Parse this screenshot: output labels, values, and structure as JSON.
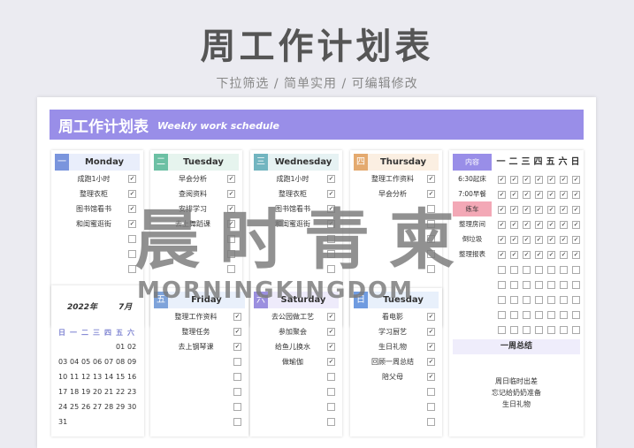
{
  "hero": {
    "title": "周工作计划表",
    "subtitle": "下拉筛选 / 简单实用 / 可编辑修改"
  },
  "banner": {
    "title": "周工作计划表",
    "subtitle": "Weekly work schedule"
  },
  "colors": {
    "purple": "#998ee8",
    "monday": "#7a95dd",
    "tuesday": "#6cc0a4",
    "wednesday": "#72b5c0",
    "thursday": "#e4aa6f",
    "friday": "#7ea3da",
    "saturday": "#9b8fdf",
    "sunday": "#6f9be0"
  },
  "days": [
    {
      "num": "一",
      "name": "Monday",
      "tasks": [
        {
          "text": "成跑1小时",
          "done": true
        },
        {
          "text": "整理衣柜",
          "done": true
        },
        {
          "text": "图书馆看书",
          "done": true
        },
        {
          "text": "和闺蜜逛街",
          "done": true
        },
        {
          "text": "",
          "done": false
        },
        {
          "text": "",
          "done": false
        },
        {
          "text": "",
          "done": false
        }
      ]
    },
    {
      "num": "二",
      "name": "Tuesday",
      "tasks": [
        {
          "text": "早会分析",
          "done": true
        },
        {
          "text": "查阅资料",
          "done": true
        },
        {
          "text": "安排学习",
          "done": true
        },
        {
          "text": "去上舞蹈课",
          "done": true
        },
        {
          "text": "",
          "done": false
        },
        {
          "text": "",
          "done": false
        },
        {
          "text": "",
          "done": false
        }
      ]
    },
    {
      "num": "三",
      "name": "Wednesday",
      "tasks": [
        {
          "text": "成跑1小时",
          "done": true
        },
        {
          "text": "整理衣柜",
          "done": true
        },
        {
          "text": "图书馆看书",
          "done": true
        },
        {
          "text": "和闺蜜逛街",
          "done": true
        },
        {
          "text": "",
          "done": false
        },
        {
          "text": "",
          "done": false
        },
        {
          "text": "",
          "done": false
        }
      ]
    },
    {
      "num": "四",
      "name": "Thursday",
      "tasks": [
        {
          "text": "整理工作资料",
          "done": true
        },
        {
          "text": "早会分析",
          "done": true
        },
        {
          "text": "",
          "done": false
        },
        {
          "text": "",
          "done": false
        },
        {
          "text": "",
          "done": false
        },
        {
          "text": "",
          "done": false
        },
        {
          "text": "",
          "done": false
        }
      ]
    },
    {
      "num": "五",
      "name": "Friday",
      "tasks": [
        {
          "text": "整理工作资料",
          "done": true
        },
        {
          "text": "整理任务",
          "done": true
        },
        {
          "text": "去上钢琴课",
          "done": true
        },
        {
          "text": "",
          "done": false
        },
        {
          "text": "",
          "done": false
        },
        {
          "text": "",
          "done": false
        },
        {
          "text": "",
          "done": false
        },
        {
          "text": "",
          "done": false
        }
      ]
    },
    {
      "num": "六",
      "name": "Saturday",
      "tasks": [
        {
          "text": "去公园做工艺",
          "done": true
        },
        {
          "text": "参加聚会",
          "done": true
        },
        {
          "text": "给鱼儿换水",
          "done": true
        },
        {
          "text": "做瑜伽",
          "done": true
        },
        {
          "text": "",
          "done": false
        },
        {
          "text": "",
          "done": false
        },
        {
          "text": "",
          "done": false
        },
        {
          "text": "",
          "done": false
        }
      ]
    },
    {
      "num": "日",
      "name": "Tuesday",
      "tasks": [
        {
          "text": "看电影",
          "done": true
        },
        {
          "text": "学习厨艺",
          "done": true
        },
        {
          "text": "生日礼物",
          "done": true
        },
        {
          "text": "回顾一周总结",
          "done": true
        },
        {
          "text": "陪父母",
          "done": true
        },
        {
          "text": "",
          "done": false
        },
        {
          "text": "",
          "done": false
        },
        {
          "text": "",
          "done": false
        }
      ]
    }
  ],
  "calendar": {
    "year": "2022年",
    "month": "7月",
    "weekdays": [
      "日",
      "一",
      "二",
      "三",
      "四",
      "五",
      "六"
    ],
    "weeks": [
      [
        "",
        "",
        "",
        "",
        "",
        "01",
        "02"
      ],
      [
        "03",
        "04",
        "05",
        "06",
        "07",
        "08",
        "09"
      ],
      [
        "10",
        "11",
        "12",
        "13",
        "14",
        "15",
        "16"
      ],
      [
        "17",
        "18",
        "19",
        "20",
        "21",
        "22",
        "23"
      ],
      [
        "24",
        "25",
        "26",
        "27",
        "28",
        "29",
        "30"
      ],
      [
        "31",
        "",
        "",
        "",
        "",
        "",
        ""
      ]
    ]
  },
  "habits": {
    "header": "内容",
    "days": [
      "一",
      "二",
      "三",
      "四",
      "五",
      "六",
      "日"
    ],
    "rows": [
      {
        "label": "6:30起床",
        "checks": [
          true,
          true,
          true,
          true,
          true,
          true,
          true
        ],
        "highlight": false
      },
      {
        "label": "7:00早餐",
        "checks": [
          true,
          true,
          true,
          true,
          true,
          true,
          true
        ],
        "highlight": false
      },
      {
        "label": "练车",
        "checks": [
          true,
          true,
          true,
          true,
          true,
          true,
          true
        ],
        "highlight": true
      },
      {
        "label": "整理房间",
        "checks": [
          true,
          true,
          true,
          true,
          true,
          true,
          true
        ],
        "highlight": false
      },
      {
        "label": "倒垃圾",
        "checks": [
          true,
          true,
          true,
          true,
          true,
          true,
          true
        ],
        "highlight": false
      },
      {
        "label": "整理报表",
        "checks": [
          true,
          true,
          true,
          true,
          true,
          true,
          true
        ],
        "highlight": false
      },
      {
        "label": "",
        "checks": [
          false,
          false,
          false,
          false,
          false,
          false,
          false
        ],
        "highlight": false
      },
      {
        "label": "",
        "checks": [
          false,
          false,
          false,
          false,
          false,
          false,
          false
        ],
        "highlight": false
      },
      {
        "label": "",
        "checks": [
          false,
          false,
          false,
          false,
          false,
          false,
          false
        ],
        "highlight": false
      },
      {
        "label": "",
        "checks": [
          false,
          false,
          false,
          false,
          false,
          false,
          false
        ],
        "highlight": false
      },
      {
        "label": "",
        "checks": [
          false,
          false,
          false,
          false,
          false,
          false,
          false
        ],
        "highlight": false
      }
    ]
  },
  "summary": {
    "title": "一周总结",
    "lines": [
      "周日临时出差",
      "忘记给奶奶准备",
      "生日礼物"
    ]
  },
  "watermark": {
    "cn": "晨时青柬",
    "en": "MORNINGKINGDOM"
  }
}
